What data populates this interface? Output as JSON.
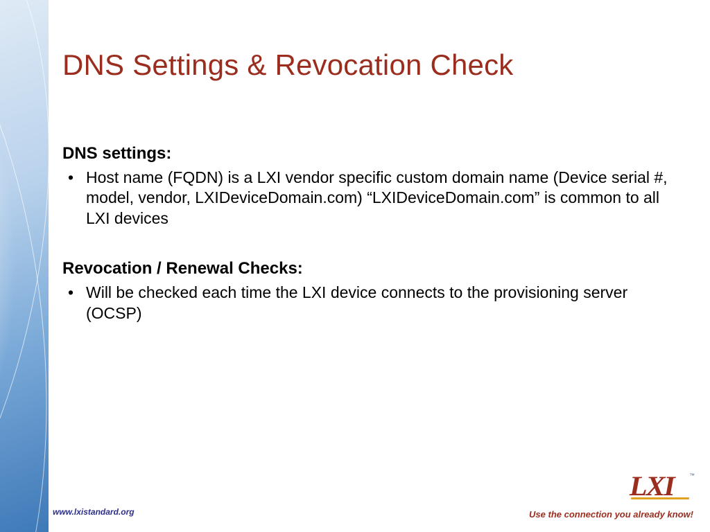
{
  "title": "DNS Settings  & Revocation Check",
  "sections": [
    {
      "heading": "DNS settings:",
      "bullets": [
        "Host name (FQDN) is a LXI vendor specific custom domain name (Device serial #, model, vendor, LXIDeviceDomain.com) “LXIDeviceDomain.com” is common to all LXI devices"
      ]
    },
    {
      "heading": "Revocation / Renewal Checks:",
      "bullets": [
        "Will be checked each time the LXI device connects to the provisioning server (OCSP)"
      ]
    }
  ],
  "footer": {
    "url": "www.lxistandard.org",
    "tagline": "Use the connection you already know!"
  },
  "logo": {
    "text": "LXI",
    "tm": "™"
  }
}
